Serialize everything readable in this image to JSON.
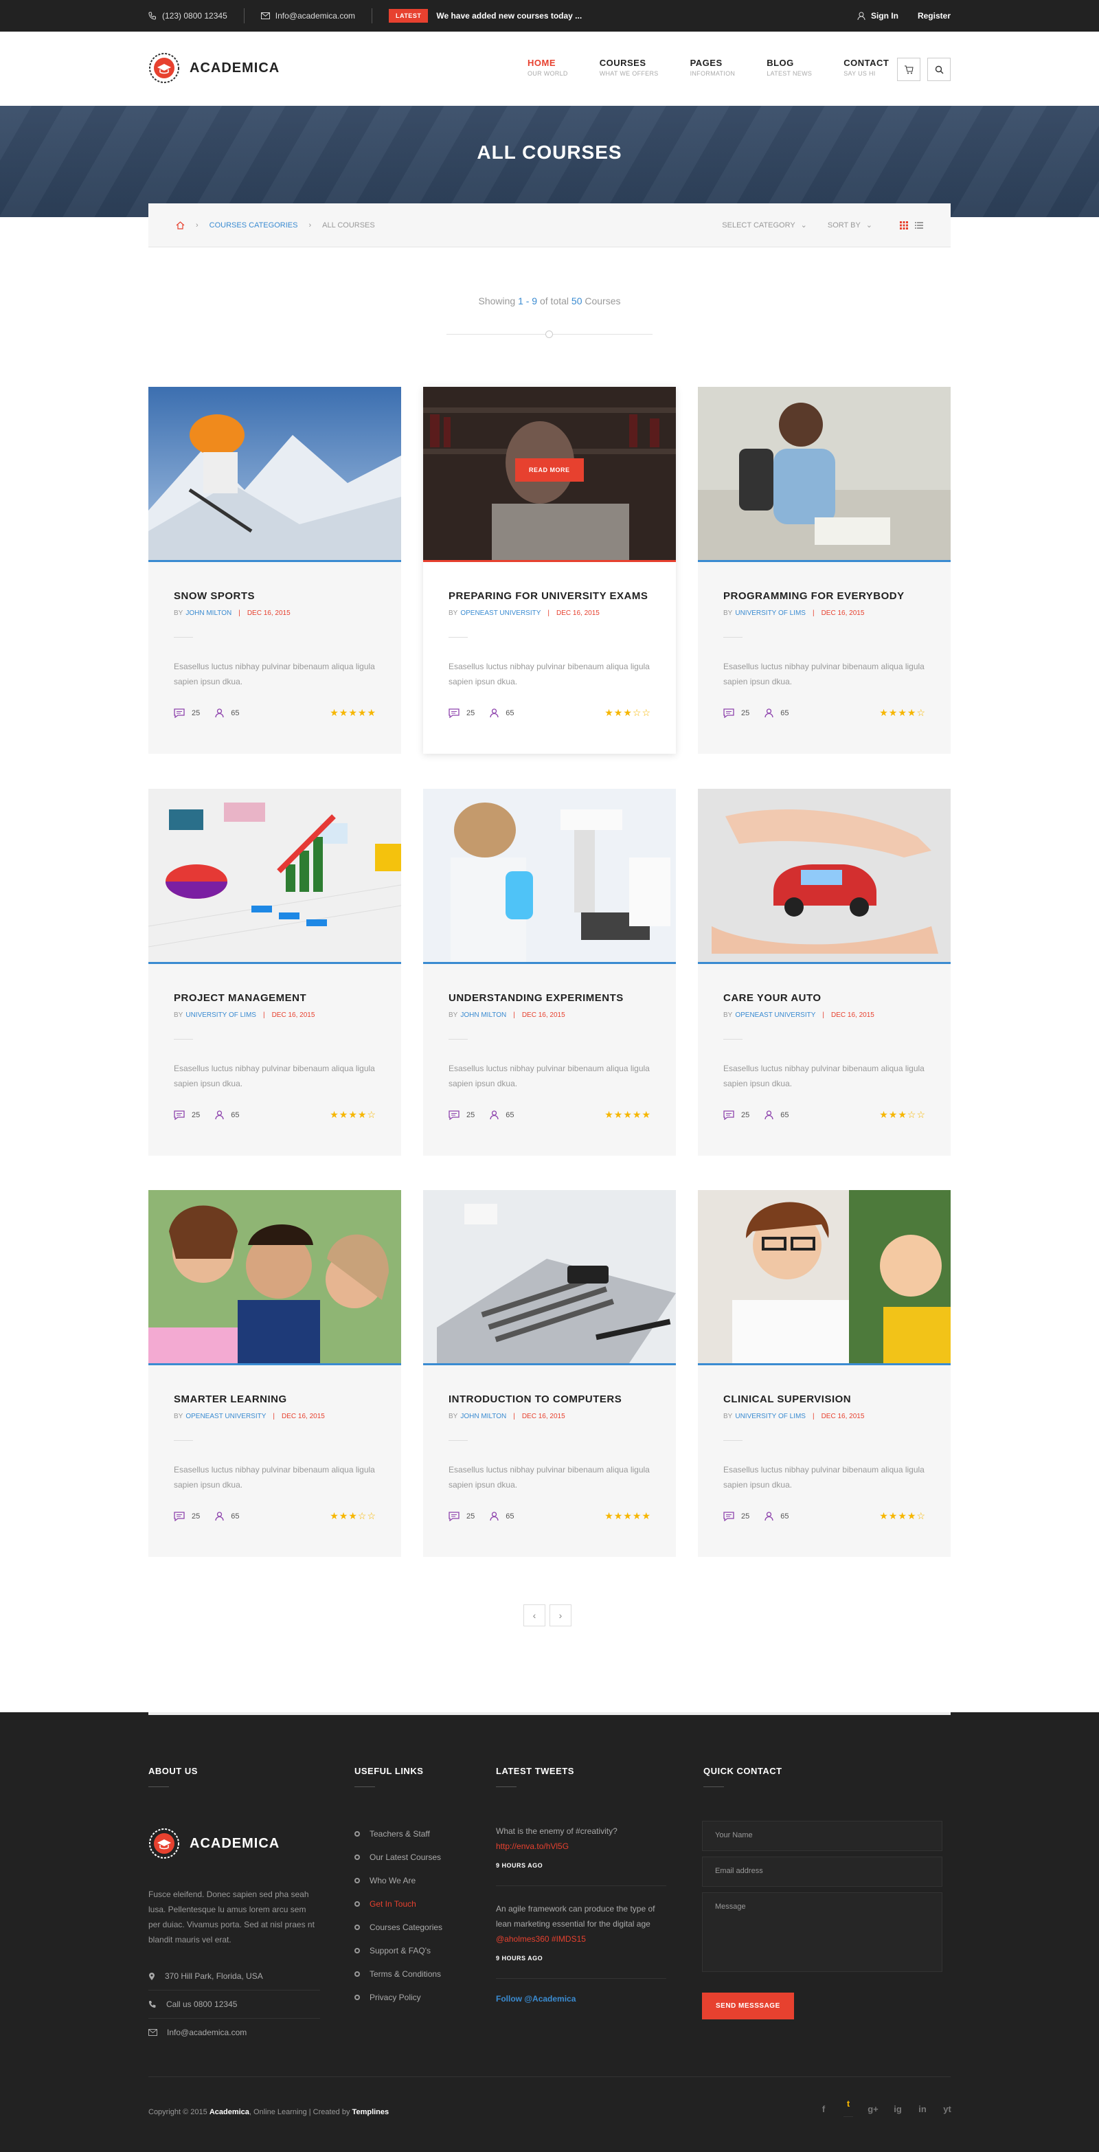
{
  "topbar": {
    "phone": "(123) 0800 12345",
    "email": "Info@academica.com",
    "latest_badge": "LATEST",
    "latest_text": "We have added new courses today ...",
    "sign_in": "Sign In",
    "register": "Register"
  },
  "header": {
    "logo_text": "ACADEMICA",
    "nav": [
      {
        "label": "HOME",
        "sub": "OUR WORLD"
      },
      {
        "label": "COURSES",
        "sub": "WHAT WE OFFERS"
      },
      {
        "label": "PAGES",
        "sub": "INFORMATION"
      },
      {
        "label": "BLOG",
        "sub": "LATEST NEWS"
      },
      {
        "label": "CONTACT",
        "sub": "SAY US HI"
      }
    ]
  },
  "banner": {
    "title": "ALL COURSES"
  },
  "breadcrumb": {
    "category": "COURSES CATEGORIES",
    "current": "ALL COURSES",
    "select_category": "SELECT CATEGORY",
    "sort_by": "SORT BY"
  },
  "showing": {
    "prefix": "Showing",
    "range": "1 - 9",
    "mid": "of total",
    "total": "50",
    "suffix": "Courses"
  },
  "courses": [
    {
      "title": "SNOW SPORTS",
      "by": "BY",
      "author": "JOHN MILTON",
      "date": "DEC 16, 2015",
      "desc": "Esasellus luctus nibhay pulvinar bibenaum aliqua ligula sapien ipsun dkua.",
      "comments": "25",
      "students": "65",
      "rating": 5
    },
    {
      "title": "PREPARING FOR UNIVERSITY EXAMS",
      "by": "BY",
      "author": "OPENEAST UNIVERSITY",
      "date": "DEC 16, 2015",
      "desc": "Esasellus luctus nibhay pulvinar bibenaum aliqua ligula sapien ipsun dkua.",
      "comments": "25",
      "students": "65",
      "rating": 3,
      "read_more": "READ MORE"
    },
    {
      "title": "PROGRAMMING FOR EVERYBODY",
      "by": "BY",
      "author": "UNIVERSITY OF LIMS",
      "date": "DEC 16, 2015",
      "desc": "Esasellus luctus nibhay pulvinar bibenaum aliqua ligula sapien ipsun dkua.",
      "comments": "25",
      "students": "65",
      "rating": 4
    },
    {
      "title": "PROJECT MANAGEMENT",
      "by": "BY",
      "author": "UNIVERSITY OF LIMS",
      "date": "DEC 16, 2015",
      "desc": "Esasellus luctus nibhay pulvinar bibenaum aliqua ligula sapien ipsun dkua.",
      "comments": "25",
      "students": "65",
      "rating": 4
    },
    {
      "title": "UNDERSTANDING EXPERIMENTS",
      "by": "BY",
      "author": "JOHN MILTON",
      "date": "DEC 16, 2015",
      "desc": "Esasellus luctus nibhay pulvinar bibenaum aliqua ligula sapien ipsun dkua.",
      "comments": "25",
      "students": "65",
      "rating": 5
    },
    {
      "title": "CARE YOUR AUTO",
      "by": "BY",
      "author": "OPENEAST UNIVERSITY",
      "date": "DEC 16, 2015",
      "desc": "Esasellus luctus nibhay pulvinar bibenaum aliqua ligula sapien ipsun dkua.",
      "comments": "25",
      "students": "65",
      "rating": 3
    },
    {
      "title": "SMARTER LEARNING",
      "by": "BY",
      "author": "OPENEAST UNIVERSITY",
      "date": "DEC 16, 2015",
      "desc": "Esasellus luctus nibhay pulvinar bibenaum aliqua ligula sapien ipsun dkua.",
      "comments": "25",
      "students": "65",
      "rating": 3
    },
    {
      "title": "INTRODUCTION TO COMPUTERS",
      "by": "BY",
      "author": "JOHN MILTON",
      "date": "DEC 16, 2015",
      "desc": "Esasellus luctus nibhay pulvinar bibenaum aliqua ligula sapien ipsun dkua.",
      "comments": "25",
      "students": "65",
      "rating": 5
    },
    {
      "title": "CLINICAL SUPERVISION",
      "by": "BY",
      "author": "UNIVERSITY OF LIMS",
      "date": "DEC 16, 2015",
      "desc": "Esasellus luctus nibhay pulvinar bibenaum aliqua ligula sapien ipsun dkua.",
      "comments": "25",
      "students": "65",
      "rating": 4
    }
  ],
  "pager": {
    "prev": "‹",
    "next": "›"
  },
  "footer": {
    "about_title": "ABOUT US",
    "logo_text": "ACADEMICA",
    "about_text": "Fusce eleifend. Donec sapien sed pha seah lusa. Pellentesque lu amus lorem arcu sem per duiac. Vivamus porta. Sed at nisl praes nt blandit mauris vel erat.",
    "address": "370 Hill Park, Florida, USA",
    "phone": "Call us 0800 12345",
    "email": "Info@academica.com",
    "links_title": "USEFUL LINKS",
    "links": [
      "Teachers & Staff",
      "Our Latest Courses",
      "Who We Are",
      "Get In Touch",
      "Courses Categories",
      "Support & FAQ's",
      "Terms & Conditions",
      "Privacy Policy"
    ],
    "tweets_title": "LATEST TWEETS",
    "tweet1_text": "What is the enemy of #creativity?",
    "tweet1_link": "http://enva.to/hVl5G",
    "tweet1_time": "9 HOURS AGO",
    "tweet2_text": "An agile framework can produce the type of lean marketing essential for the digital age",
    "tweet2_link": "@aholmes360 #IMDS15",
    "tweet2_time": "9 HOURS AGO",
    "follow": "Follow @Academica",
    "contact_title": "QUICK CONTACT",
    "name_placeholder": "Your Name",
    "email_placeholder": "Email address",
    "message_placeholder": "Message",
    "send": "SEND MESSSAGE",
    "copy_prefix": "Copyright © 2015",
    "copy_brand": "Academica",
    "copy_mid": ", Online Learning  |  Created by",
    "copy_author": "Templines",
    "social": [
      "f",
      "t",
      "g+",
      "ig",
      "in",
      "yt"
    ]
  },
  "colors": {
    "accent": "#e7412f",
    "blue": "#3a8bd1",
    "star": "#f6b600",
    "dark": "#222222"
  }
}
